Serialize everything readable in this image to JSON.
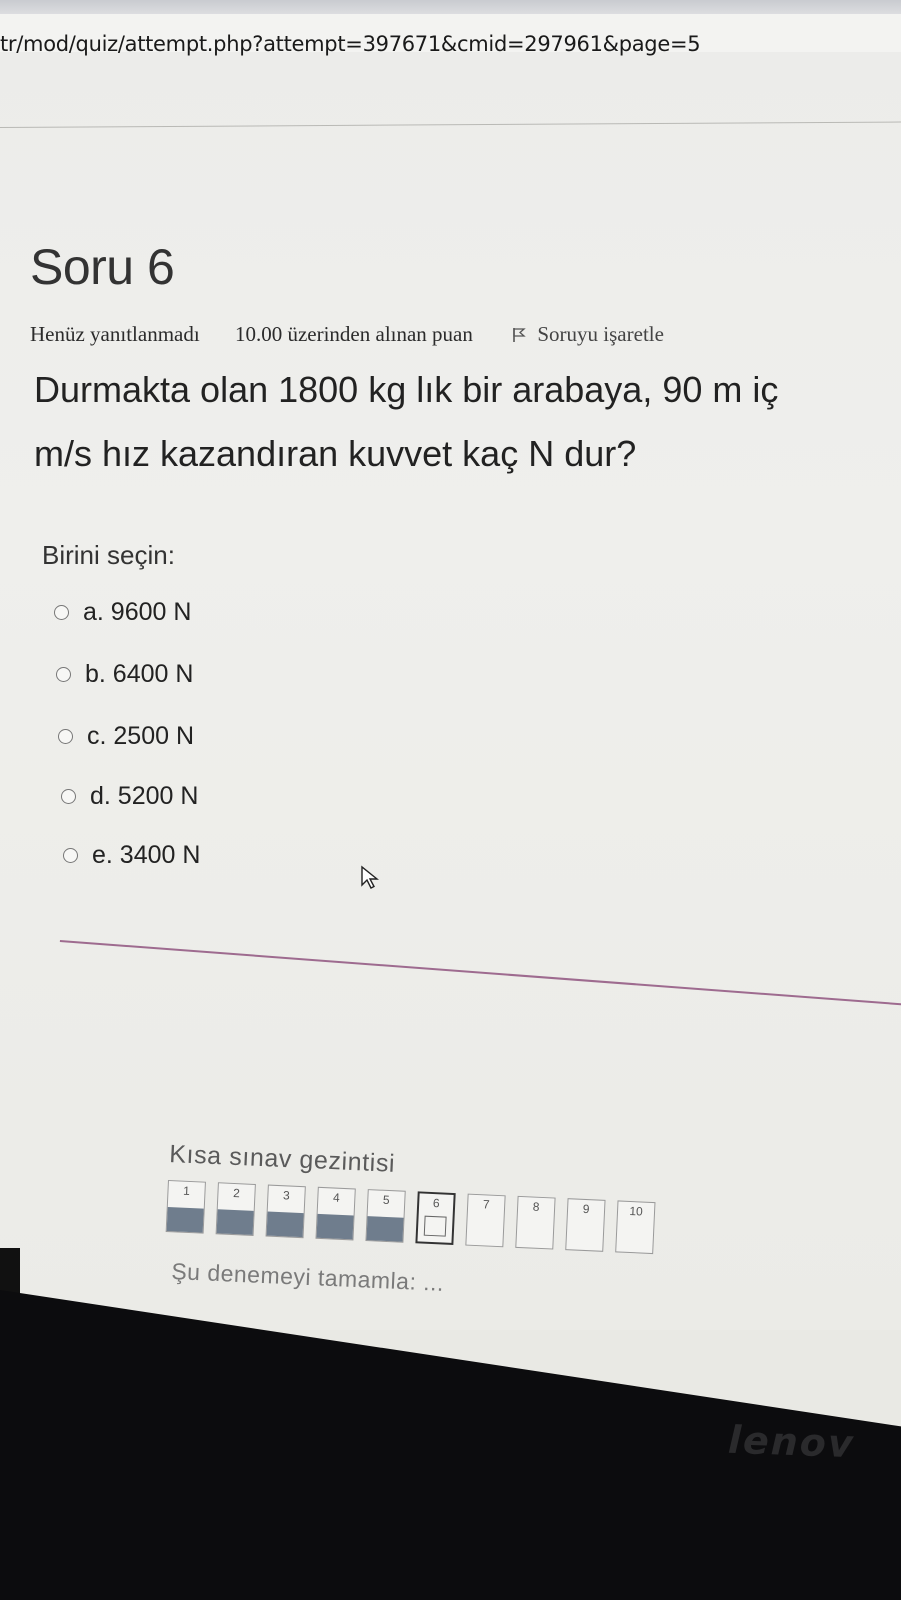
{
  "browser": {
    "url": "tr/mod/quiz/attempt.php?attempt=397671&cmid=297961&page=5"
  },
  "question": {
    "title": "Soru 6",
    "status": "Henüz yanıtlanmadı",
    "points": "10.00 üzerinden alınan puan",
    "flag_label": "Soruyu işaretle",
    "text_line1": "Durmakta olan 1800 kg lık bir arabaya, 90 m iç",
    "text_line2": "m/s hız kazandıran kuvvet kaç N dur?",
    "prompt": "Birini seçin:",
    "options": [
      {
        "label": "a. 9600 N"
      },
      {
        "label": "b. 6400 N"
      },
      {
        "label": "c. 2500 N"
      },
      {
        "label": "d. 5200 N"
      },
      {
        "label": "e. 3400 N"
      }
    ]
  },
  "quiz_navigation": {
    "title": "Kısa sınav gezintisi",
    "buttons": [
      "1",
      "2",
      "3",
      "4",
      "5",
      "6",
      "7",
      "8",
      "9",
      "10"
    ],
    "answered": [
      1,
      2,
      3,
      4,
      5
    ],
    "current": 6,
    "finish_link": "Şu denemeyi tamamla: ..."
  },
  "device": {
    "brand": "lenov"
  },
  "colors": {
    "answered_fill": "#6f7d8d",
    "separator": "#8a4a78"
  }
}
